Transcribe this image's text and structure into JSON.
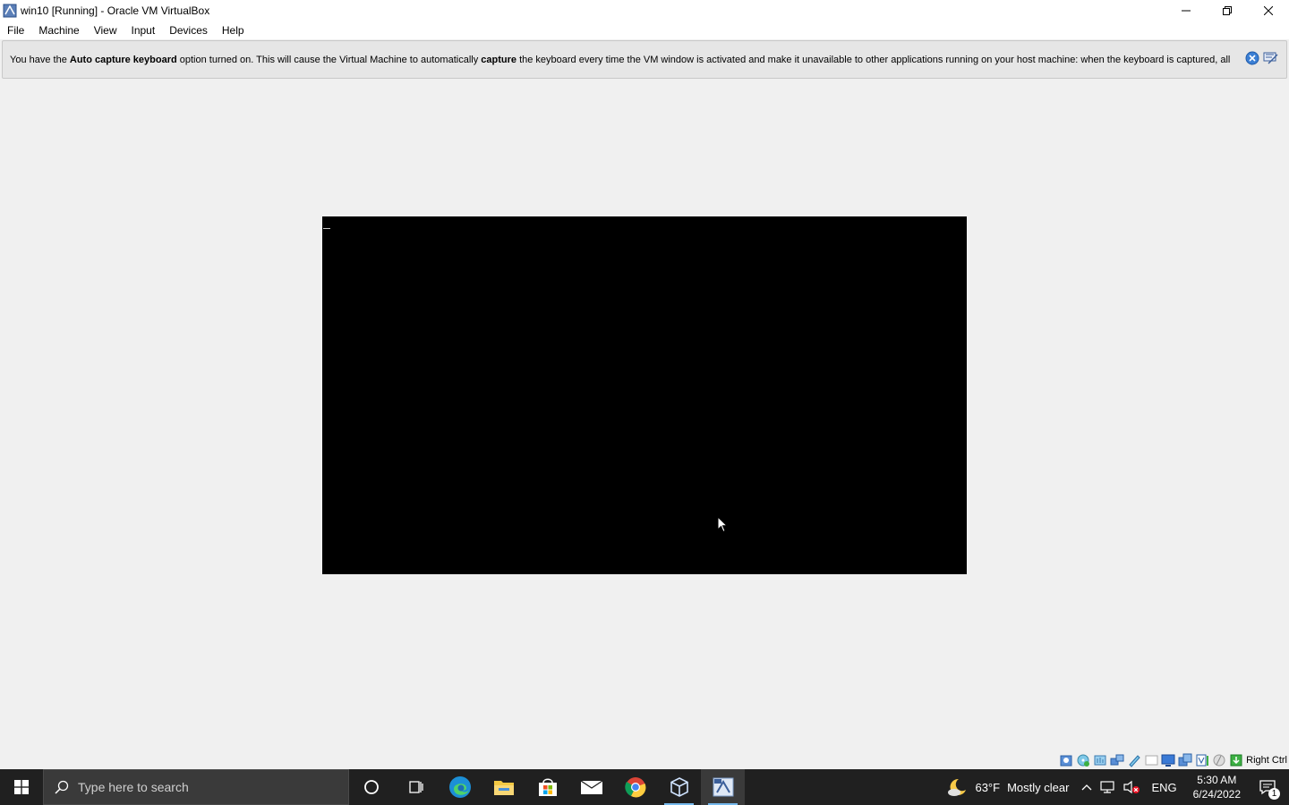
{
  "window": {
    "title": "win10 [Running] - Oracle VM VirtualBox"
  },
  "menu": {
    "items": [
      "File",
      "Machine",
      "View",
      "Input",
      "Devices",
      "Help"
    ]
  },
  "notice": {
    "part1": "You have the ",
    "bold1": "Auto capture keyboard",
    "part2": " option turned on. This will cause the Virtual Machine to automatically ",
    "bold2": "capture",
    "part3": " the keyboard every time the VM window is activated and make it unavailable to other applications running on your host machine: when the keyboard is captured, all"
  },
  "statusbar": {
    "host_key": "Right Ctrl",
    "icons": [
      "hard-disk-icon",
      "optical-disk-icon",
      "audio-icon",
      "network-icon",
      "usb-icon",
      "shared-folder-icon",
      "display-icon",
      "recording-icon",
      "cpu-icon",
      "mouse-integration-icon",
      "keyboard-capture-icon"
    ]
  },
  "taskbar": {
    "search_placeholder": "Type here to search",
    "apps": [
      "cortana-icon",
      "task-view-icon",
      "edge-icon",
      "file-explorer-icon",
      "store-icon",
      "mail-icon",
      "chrome-icon",
      "virtualbox-icon",
      "vm-window-icon"
    ]
  },
  "tray": {
    "temperature": "63°F",
    "weather": "Mostly clear",
    "language": "ENG",
    "time": "5:30 AM",
    "date": "6/24/2022",
    "notifications_count": "1"
  },
  "colors": {
    "taskbar_bg": "#202020",
    "accent": "#76b9ed",
    "vm_screen": "#000000"
  }
}
